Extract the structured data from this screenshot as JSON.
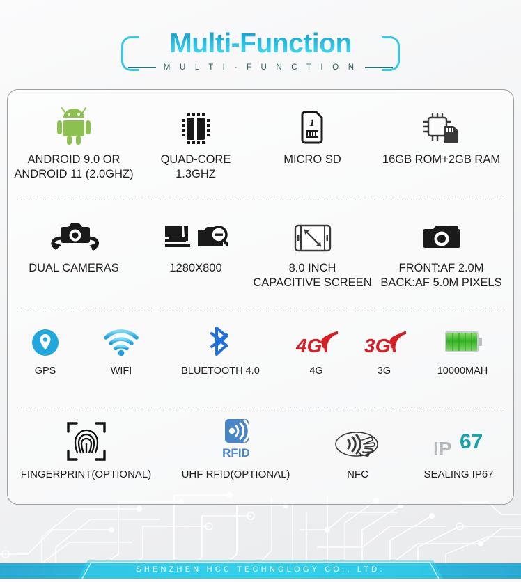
{
  "header": {
    "title": "Multi-Function",
    "subtitle": "M U L T I - F U N C T I O N",
    "title_gradient_top": "#1b8fb8",
    "title_gradient_bottom": "#7fe4f5",
    "bracket_color": "#3cc6e4",
    "subtitle_color": "#2b5f68"
  },
  "specs": {
    "rows": [
      {
        "cells": [
          {
            "icon": "android-robot-icon",
            "label": "ANDROID 9.0 OR\nANDROID 11 (2.0GHZ)",
            "color": "#8cc051"
          },
          {
            "icon": "cpu-chip-icon",
            "label": "QUAD-CORE\n1.3GHZ",
            "color": "#1a1a1a"
          },
          {
            "icon": "micro-sd-card-icon",
            "label": "MICRO SD",
            "color": "#1a1a1a"
          },
          {
            "icon": "memory-chip-icon",
            "label": "16GB ROM+2GB RAM",
            "color": "#3a3a3a"
          }
        ]
      },
      {
        "cells": [
          {
            "icon": "dual-camera-rotate-icon",
            "label": "DUAL CAMERAS",
            "color": "#1a1a1a"
          },
          {
            "icon": "resolution-zoom-icon",
            "label": "1280X800",
            "color": "#1a1a1a"
          },
          {
            "icon": "tablet-diagonal-icon",
            "label": "8.0 INCH\nCAPACITIVE SCREEN",
            "color": "#3a3a3a"
          },
          {
            "icon": "camera-icon",
            "label": "FRONT:AF 2.0M\nBACK:AF 5.0M PIXELS",
            "color": "#1a1a1a"
          }
        ]
      },
      {
        "cells": [
          {
            "icon": "gps-pin-icon",
            "label": "GPS",
            "color": "#22a7dd"
          },
          {
            "icon": "wifi-icon",
            "label": "WIFI",
            "color": "#2ab4e8"
          },
          {
            "icon": "bluetooth-icon",
            "label": "BLUETOOTH 4.0",
            "color": "#1f6fdc"
          },
          {
            "icon": "4g-signal-icon",
            "label": "4G",
            "color": "#d62027"
          },
          {
            "icon": "3g-signal-icon",
            "label": "3G",
            "color": "#d62027"
          },
          {
            "icon": "battery-icon",
            "label": "10000MAH",
            "color": "#4cbb3c"
          }
        ]
      },
      {
        "cells": [
          {
            "icon": "fingerprint-icon",
            "label": "FINGERPRINT(OPTIONAL)",
            "color": "#111111"
          },
          {
            "icon": "rfid-icon",
            "label": "UHF RFID(OPTIONAL)",
            "color": "#4a86c5"
          },
          {
            "icon": "nfc-icon",
            "label": "NFC",
            "color": "#3a3a3a"
          },
          {
            "icon": "ip67-icon",
            "label": "SEALING IP67",
            "color": "#19a3a8"
          }
        ]
      }
    ],
    "icon_labels": {
      "micro_sd_number": "1",
      "rfid_text": "RFID",
      "ip_prefix": "IP",
      "ip_rating": "67",
      "tag_4g": "4G",
      "tag_3g": "3G"
    }
  },
  "footer": {
    "company": "SHENZHEN HCC TECHNOLOGY CO., LTD.",
    "banner_color_left": "#2ba9d4",
    "banner_color_right": "#30d7ee"
  }
}
